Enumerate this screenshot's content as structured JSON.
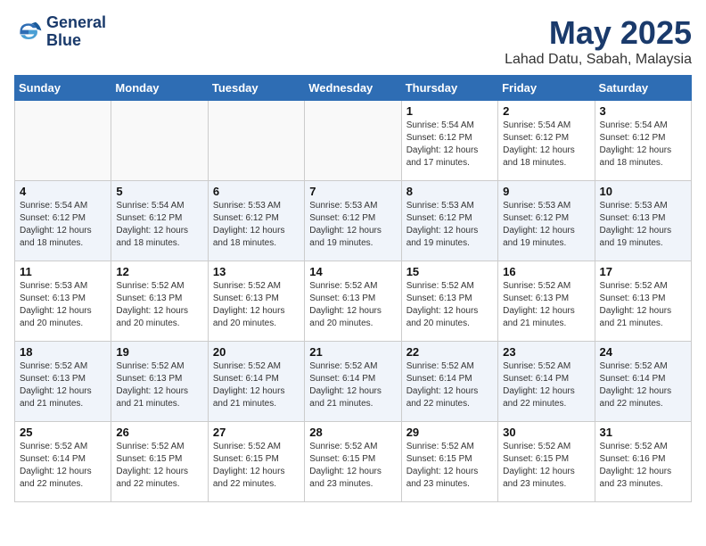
{
  "header": {
    "logo_line1": "General",
    "logo_line2": "Blue",
    "month": "May 2025",
    "location": "Lahad Datu, Sabah, Malaysia"
  },
  "weekdays": [
    "Sunday",
    "Monday",
    "Tuesday",
    "Wednesday",
    "Thursday",
    "Friday",
    "Saturday"
  ],
  "weeks": [
    [
      {
        "day": "",
        "info": ""
      },
      {
        "day": "",
        "info": ""
      },
      {
        "day": "",
        "info": ""
      },
      {
        "day": "",
        "info": ""
      },
      {
        "day": "1",
        "info": "Sunrise: 5:54 AM\nSunset: 6:12 PM\nDaylight: 12 hours\nand 17 minutes."
      },
      {
        "day": "2",
        "info": "Sunrise: 5:54 AM\nSunset: 6:12 PM\nDaylight: 12 hours\nand 18 minutes."
      },
      {
        "day": "3",
        "info": "Sunrise: 5:54 AM\nSunset: 6:12 PM\nDaylight: 12 hours\nand 18 minutes."
      }
    ],
    [
      {
        "day": "4",
        "info": "Sunrise: 5:54 AM\nSunset: 6:12 PM\nDaylight: 12 hours\nand 18 minutes."
      },
      {
        "day": "5",
        "info": "Sunrise: 5:54 AM\nSunset: 6:12 PM\nDaylight: 12 hours\nand 18 minutes."
      },
      {
        "day": "6",
        "info": "Sunrise: 5:53 AM\nSunset: 6:12 PM\nDaylight: 12 hours\nand 18 minutes."
      },
      {
        "day": "7",
        "info": "Sunrise: 5:53 AM\nSunset: 6:12 PM\nDaylight: 12 hours\nand 19 minutes."
      },
      {
        "day": "8",
        "info": "Sunrise: 5:53 AM\nSunset: 6:12 PM\nDaylight: 12 hours\nand 19 minutes."
      },
      {
        "day": "9",
        "info": "Sunrise: 5:53 AM\nSunset: 6:12 PM\nDaylight: 12 hours\nand 19 minutes."
      },
      {
        "day": "10",
        "info": "Sunrise: 5:53 AM\nSunset: 6:13 PM\nDaylight: 12 hours\nand 19 minutes."
      }
    ],
    [
      {
        "day": "11",
        "info": "Sunrise: 5:53 AM\nSunset: 6:13 PM\nDaylight: 12 hours\nand 20 minutes."
      },
      {
        "day": "12",
        "info": "Sunrise: 5:52 AM\nSunset: 6:13 PM\nDaylight: 12 hours\nand 20 minutes."
      },
      {
        "day": "13",
        "info": "Sunrise: 5:52 AM\nSunset: 6:13 PM\nDaylight: 12 hours\nand 20 minutes."
      },
      {
        "day": "14",
        "info": "Sunrise: 5:52 AM\nSunset: 6:13 PM\nDaylight: 12 hours\nand 20 minutes."
      },
      {
        "day": "15",
        "info": "Sunrise: 5:52 AM\nSunset: 6:13 PM\nDaylight: 12 hours\nand 20 minutes."
      },
      {
        "day": "16",
        "info": "Sunrise: 5:52 AM\nSunset: 6:13 PM\nDaylight: 12 hours\nand 21 minutes."
      },
      {
        "day": "17",
        "info": "Sunrise: 5:52 AM\nSunset: 6:13 PM\nDaylight: 12 hours\nand 21 minutes."
      }
    ],
    [
      {
        "day": "18",
        "info": "Sunrise: 5:52 AM\nSunset: 6:13 PM\nDaylight: 12 hours\nand 21 minutes."
      },
      {
        "day": "19",
        "info": "Sunrise: 5:52 AM\nSunset: 6:13 PM\nDaylight: 12 hours\nand 21 minutes."
      },
      {
        "day": "20",
        "info": "Sunrise: 5:52 AM\nSunset: 6:14 PM\nDaylight: 12 hours\nand 21 minutes."
      },
      {
        "day": "21",
        "info": "Sunrise: 5:52 AM\nSunset: 6:14 PM\nDaylight: 12 hours\nand 21 minutes."
      },
      {
        "day": "22",
        "info": "Sunrise: 5:52 AM\nSunset: 6:14 PM\nDaylight: 12 hours\nand 22 minutes."
      },
      {
        "day": "23",
        "info": "Sunrise: 5:52 AM\nSunset: 6:14 PM\nDaylight: 12 hours\nand 22 minutes."
      },
      {
        "day": "24",
        "info": "Sunrise: 5:52 AM\nSunset: 6:14 PM\nDaylight: 12 hours\nand 22 minutes."
      }
    ],
    [
      {
        "day": "25",
        "info": "Sunrise: 5:52 AM\nSunset: 6:14 PM\nDaylight: 12 hours\nand 22 minutes."
      },
      {
        "day": "26",
        "info": "Sunrise: 5:52 AM\nSunset: 6:15 PM\nDaylight: 12 hours\nand 22 minutes."
      },
      {
        "day": "27",
        "info": "Sunrise: 5:52 AM\nSunset: 6:15 PM\nDaylight: 12 hours\nand 22 minutes."
      },
      {
        "day": "28",
        "info": "Sunrise: 5:52 AM\nSunset: 6:15 PM\nDaylight: 12 hours\nand 23 minutes."
      },
      {
        "day": "29",
        "info": "Sunrise: 5:52 AM\nSunset: 6:15 PM\nDaylight: 12 hours\nand 23 minutes."
      },
      {
        "day": "30",
        "info": "Sunrise: 5:52 AM\nSunset: 6:15 PM\nDaylight: 12 hours\nand 23 minutes."
      },
      {
        "day": "31",
        "info": "Sunrise: 5:52 AM\nSunset: 6:16 PM\nDaylight: 12 hours\nand 23 minutes."
      }
    ]
  ]
}
